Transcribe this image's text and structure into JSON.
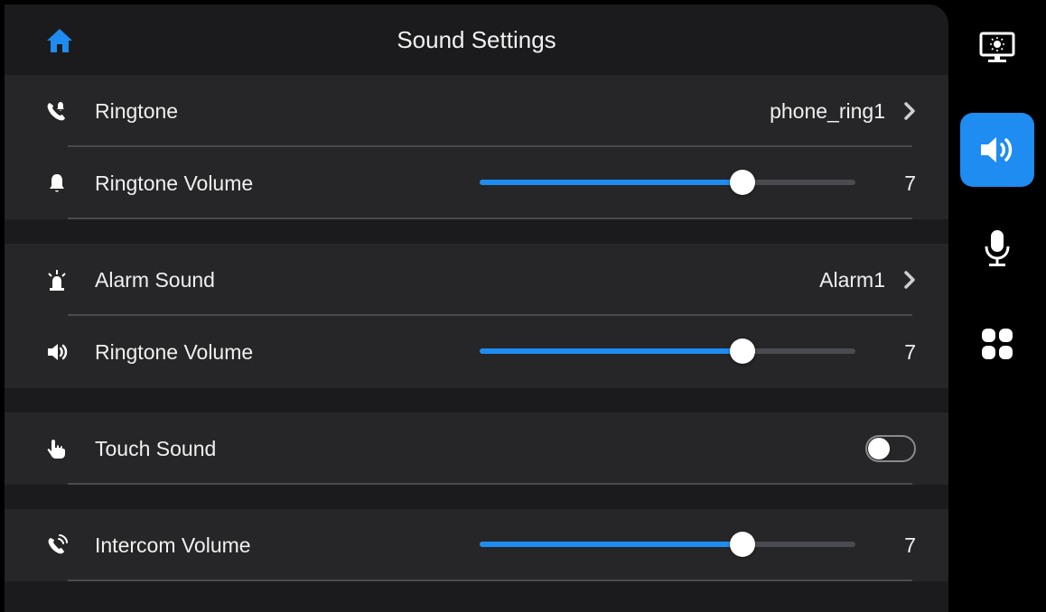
{
  "header": {
    "title": "Sound Settings",
    "home_icon": "home-icon"
  },
  "colors": {
    "accent": "#1e8cf0",
    "panel": "#1b1b1d",
    "group": "#262628"
  },
  "groups": [
    {
      "rows": [
        {
          "label": "Ringtone",
          "icon": "phone-ring-icon",
          "value": "phone_ring1"
        },
        {
          "label": "Ringtone Volume",
          "icon": "bell-icon",
          "volume": "7",
          "level": 0.7
        }
      ]
    },
    {
      "rows": [
        {
          "label": "Alarm Sound",
          "icon": "alarm-light-icon",
          "value": "Alarm1"
        },
        {
          "label": "Ringtone Volume",
          "icon": "speaker-icon",
          "volume": "7",
          "level": 0.7
        }
      ]
    },
    {
      "rows": [
        {
          "label": "Touch Sound",
          "icon": "hand-tap-icon",
          "toggle": false
        }
      ]
    },
    {
      "rows": [
        {
          "label": "Intercom Volume",
          "icon": "phone-wave-icon",
          "volume": "7",
          "level": 0.7
        }
      ]
    }
  ],
  "sidebar": {
    "items": [
      {
        "icon": "display-brightness-icon",
        "active": false
      },
      {
        "icon": "speaker-icon",
        "active": true
      },
      {
        "icon": "microphone-icon",
        "active": false
      },
      {
        "icon": "apps-grid-icon",
        "active": false
      }
    ]
  }
}
